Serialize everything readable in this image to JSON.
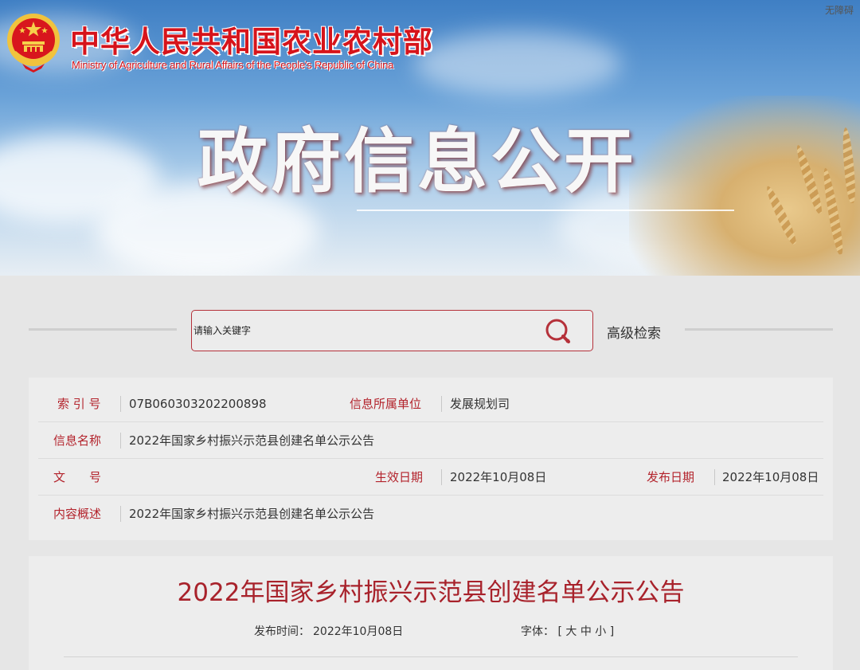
{
  "header": {
    "ministry_cn": "中华人民共和国农业农村部",
    "ministry_en": "Ministry of Agriculture and Rural Affairs of the People's Republic of China",
    "banner_title": "政府信息公开",
    "accessibility": "无障碍"
  },
  "search": {
    "placeholder": "请输入关键字",
    "advanced_label": "高级检索",
    "icon": "search-icon"
  },
  "info": {
    "index_label": "索 引 号",
    "index_value": "07B060303202200898",
    "unit_label": "信息所属单位",
    "unit_value": "发展规划司",
    "name_label": "信息名称",
    "name_value": "2022年国家乡村振兴示范县创建名单公示公告",
    "doc_label": "文　　号",
    "doc_value": "",
    "effective_label": "生效日期",
    "effective_value": "2022年10月08日",
    "publish_label": "发布日期",
    "publish_value": "2022年10月08日",
    "summary_label": "内容概述",
    "summary_value": "2022年国家乡村振兴示范县创建名单公示公告"
  },
  "article": {
    "title": "2022年国家乡村振兴示范县创建名单公示公告",
    "publish_time_label": "发布时间：",
    "publish_time": "2022年10月08日",
    "font_label": "字体：",
    "font_open": "[",
    "font_large": "大",
    "font_medium": "中",
    "font_small": "小",
    "font_close": "]"
  },
  "colors": {
    "brand_red": "#d6141b",
    "label_red": "#b3232c",
    "title_red": "#a8222b"
  }
}
